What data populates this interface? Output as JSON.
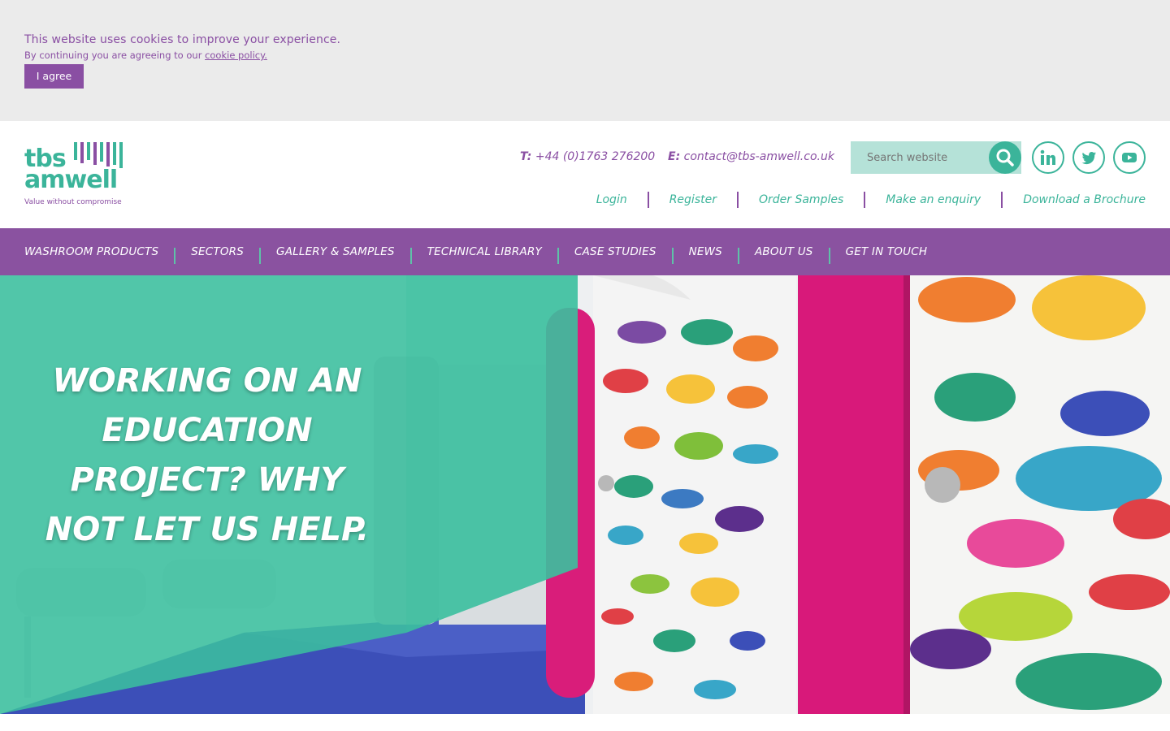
{
  "cookie": {
    "line1": "This website uses cookies to improve your experience.",
    "line2_prefix": "By continuing you are agreeing to our ",
    "policy_link": "cookie policy.",
    "agree_label": "I agree"
  },
  "logo": {
    "line1": "tbs",
    "line2": "amwell",
    "tagline": "Value without compromise"
  },
  "contact": {
    "phone_prefix": "T:",
    "phone": "+44 (0)1763 276200",
    "email_prefix": "E:",
    "email": "contact@tbs-amwell.co.uk"
  },
  "search": {
    "placeholder": "Search website",
    "icon": "search-icon"
  },
  "social": {
    "linkedin": "linkedin-icon",
    "twitter": "twitter-icon",
    "youtube": "youtube-icon"
  },
  "sublinks": [
    "Login",
    "Register",
    "Order Samples",
    "Make an enquiry",
    "Download a Brochure"
  ],
  "nav": [
    "WASHROOM PRODUCTS",
    "SECTORS",
    "GALLERY & SAMPLES",
    "TECHNICAL LIBRARY",
    "CASE STUDIES",
    "NEWS",
    "ABOUT US",
    "GET IN TOUCH"
  ],
  "hero": {
    "title": "WORKING ON AN EDUCATION PROJECT? WHY NOT LET US HELP."
  },
  "colors": {
    "brand_purple": "#8a4fa3",
    "brand_teal": "#3bb49a",
    "cookie_bg": "#ebebeb",
    "nav_bg": "#8a52a0"
  }
}
